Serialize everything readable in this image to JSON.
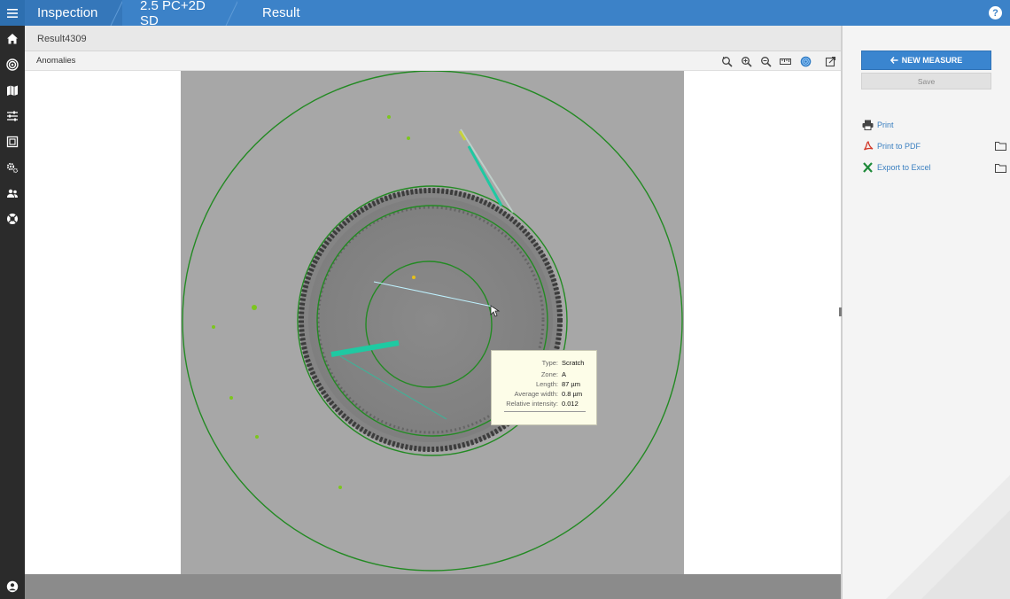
{
  "header": {
    "breadcrumbs": [
      "Inspection",
      "2.5 PC+2D SD",
      "Result"
    ],
    "help_label": "?"
  },
  "nav": {
    "items": [
      "home-icon",
      "target-icon",
      "map-icon",
      "sliders-icon",
      "gallery-icon",
      "settings-icon",
      "users-icon",
      "support-icon"
    ],
    "bottom": "account-icon"
  },
  "result": {
    "title": "Result4309",
    "section_label": "Anomalies",
    "tools": [
      "zoom-reset-icon",
      "zoom-in-icon",
      "zoom-out-icon",
      "ruler-icon",
      "overlay-icon",
      "export-view-icon"
    ]
  },
  "tooltip": {
    "rows": [
      {
        "key": "Type:",
        "value": "Scratch"
      },
      {
        "key": "Zone:",
        "value": "A"
      },
      {
        "key": "Length:",
        "value": "87 µm"
      },
      {
        "key": "Average width:",
        "value": "0.8 µm"
      },
      {
        "key": "Relative intensity:",
        "value": "0.012"
      }
    ]
  },
  "panel": {
    "new_measure_label": "NEW MEASURE",
    "save_label": "Save",
    "actions": [
      {
        "label": "Print",
        "icon": "printer-icon"
      },
      {
        "label": "Print to PDF",
        "icon": "pdf-icon"
      },
      {
        "label": "Export to Excel",
        "icon": "excel-icon"
      }
    ]
  },
  "colors": {
    "header_blue": "#3c82c8",
    "nav_dark": "#2b2b2b",
    "zone_green": "#2e8b2e",
    "scratch_teal": "#20c8a0",
    "link_blue": "#3a7fc0"
  }
}
